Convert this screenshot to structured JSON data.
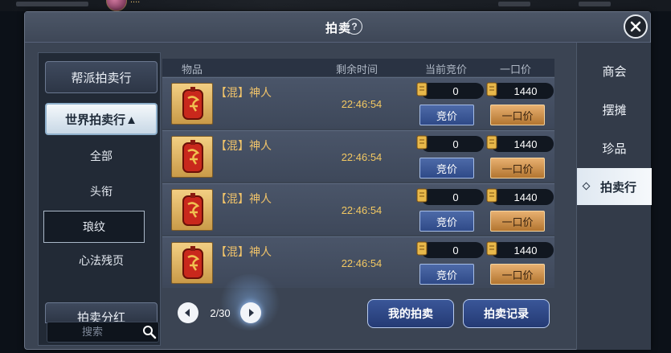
{
  "top": {
    "player_name": "...."
  },
  "window": {
    "title": "拍卖",
    "help_label": "?"
  },
  "left_menu": {
    "guild_auction": "帮派拍卖行",
    "world_auction": "世界拍卖行▲",
    "sub_items": [
      "全部",
      "头衔",
      "琅纹",
      "心法残页"
    ],
    "selected_sub": "琅纹",
    "bonus": "拍卖分红",
    "search_placeholder": "搜索"
  },
  "table": {
    "headers": {
      "item": "物品",
      "time": "剩余时间",
      "current": "当前竞价",
      "buyout": "一口价"
    },
    "rows": [
      {
        "name": "【混】神人",
        "time": "22:46:54",
        "current": "0",
        "buyout": "1440",
        "bid_label": "竞价",
        "buy_label": "一口价"
      },
      {
        "name": "【混】神人",
        "time": "22:46:54",
        "current": "0",
        "buyout": "1440",
        "bid_label": "竞价",
        "buy_label": "一口价"
      },
      {
        "name": "【混】神人",
        "time": "22:46:54",
        "current": "0",
        "buyout": "1440",
        "bid_label": "竞价",
        "buy_label": "一口价"
      },
      {
        "name": "【混】神人",
        "time": "22:46:54",
        "current": "0",
        "buyout": "1440",
        "bid_label": "竞价",
        "buy_label": "一口价"
      }
    ]
  },
  "pager": {
    "text": "2/30"
  },
  "bottom_buttons": {
    "my_auction": "我的拍卖",
    "records": "拍卖记录"
  },
  "right_tabs": {
    "items": [
      "商会",
      "摆摊",
      "珍品",
      "拍卖行"
    ],
    "active": "拍卖行"
  },
  "colors": {
    "gold_text": "#f0c36a",
    "bid_blue": "#2f4a88",
    "buyout_orange": "#b27530"
  }
}
